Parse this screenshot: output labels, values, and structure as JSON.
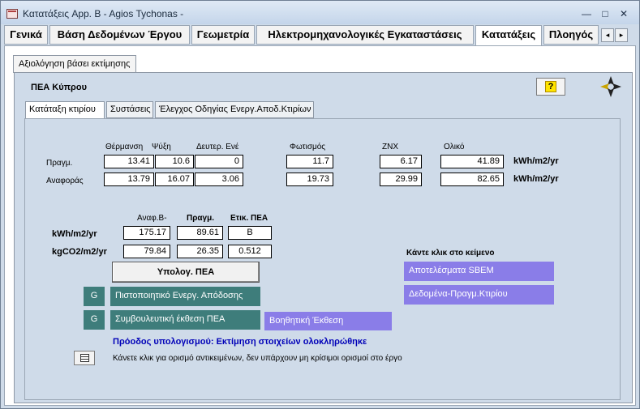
{
  "window": {
    "title": "Κατατάξεις App. B - Agios Tychonas -",
    "min_glyph": "—",
    "max_glyph": "□",
    "close_glyph": "✕"
  },
  "top_tabs": [
    {
      "label": "Γενικά",
      "active": false
    },
    {
      "label": "Βάση Δεδομένων Έργου",
      "active": false
    },
    {
      "label": "Γεωμετρία",
      "active": false
    },
    {
      "label": "Ηλεκτρομηχανολογικές Εγκαταστάσεις",
      "active": false
    },
    {
      "label": "Κατατάξεις",
      "active": true
    },
    {
      "label": "Πλοηγός",
      "active": false
    }
  ],
  "tab_scroll": {
    "left_glyph": "◂",
    "right_glyph": "▸"
  },
  "subtab": {
    "label": "Αξιολόγηση βάσει εκτίμησης"
  },
  "panel": {
    "title": "ΠΕΑ Κύπρου",
    "help_glyph": "?"
  },
  "inner_tabs": [
    {
      "label": "Κατάταξη  κτιρίου",
      "active": true
    },
    {
      "label": "Συστάσεις",
      "active": false
    },
    {
      "label": "Έλεγχος Οδηγίας Ενεργ.Αποδ.Κτιρίων",
      "active": false
    }
  ],
  "energy_table": {
    "headers": [
      "Θέρμανση",
      "Ψύξη",
      "Δευτερ. Ενέ",
      "Φωτισμός",
      "ZNX",
      "Ολικό"
    ],
    "rows": [
      {
        "label": "Πραγμ.",
        "values": [
          "13.41",
          "10.6",
          "0",
          "11.7",
          "6.17",
          "41.89"
        ],
        "unit": "kWh/m2/yr"
      },
      {
        "label": "Αναφοράς",
        "values": [
          "13.79",
          "16.07",
          "3.06",
          "19.73",
          "29.99",
          "82.65"
        ],
        "unit": "kWh/m2/yr"
      }
    ]
  },
  "summary_table": {
    "headers": [
      "Αναφ.Β-",
      "Πραγμ.",
      "Ετικ. ΠΕΑ"
    ],
    "rows": [
      {
        "label": "kWh/m2/yr",
        "values": [
          "175.17",
          "89.61",
          "B"
        ]
      },
      {
        "label": "kgCO2/m2/yr",
        "values": [
          "79.84",
          "26.35",
          "0.512"
        ]
      }
    ]
  },
  "calc_button": {
    "label": "Υπολογ. ΠΕΑ"
  },
  "g_label": "G",
  "certificate_button": {
    "label": "Πιστοποιητικό  Ενεργ. Απόδοσης"
  },
  "advisory_button": {
    "label": "Συμβουλευτική έκθεση ΠΕΑ"
  },
  "help_report_button": {
    "label": "Βοηθητική Έκθεση"
  },
  "click_prompt": "Κάντε κλικ στο κείμενο",
  "sbem_results_button": {
    "label": "Αποτελέσματα SBEM"
  },
  "building_data_button": {
    "label": "Δεδομένα-Πραγμ.Κτιρίου"
  },
  "progress": "Πρόοδος υπολογισμού: Εκτίμηση στοιχείων  ολοκληρώθηκε",
  "objects_note": "Κάνετε κλικ για ορισμό αντικειμένων, δεν υπάρχουν μη κρίσιμοι ορισμοί στο έργο",
  "colors": {
    "teal": "#3e7d7b",
    "purple": "#8a7de8",
    "progress_blue": "#0000b8",
    "panel_bg": "#cfdbe9"
  }
}
